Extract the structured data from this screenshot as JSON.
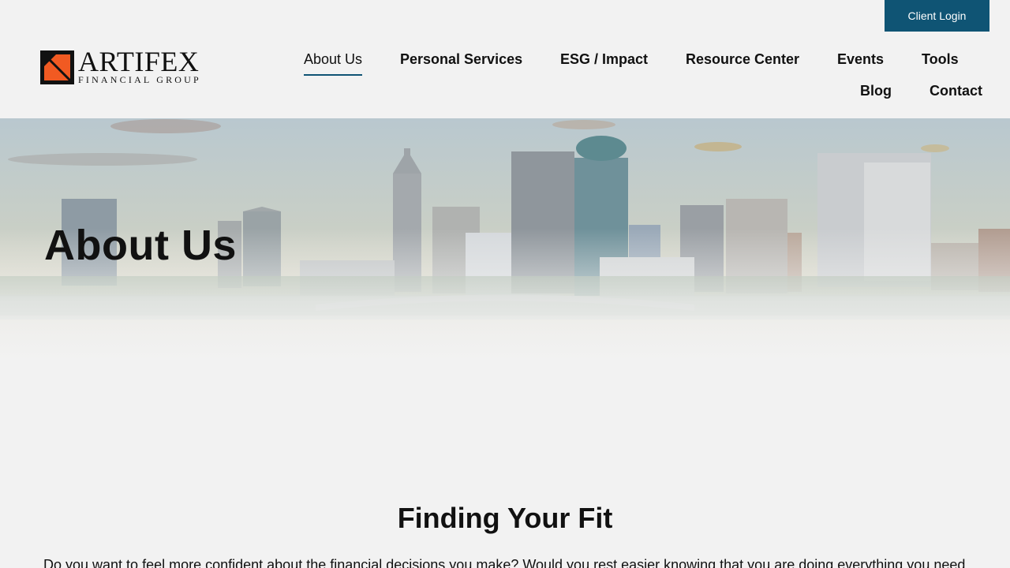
{
  "header": {
    "client_login": "Client Login",
    "logo": {
      "name": "ARTIFEX",
      "subtitle": "FINANCIAL GROUP"
    },
    "nav": [
      {
        "label": "About Us",
        "active": true
      },
      {
        "label": "Personal Services"
      },
      {
        "label": "ESG / Impact"
      },
      {
        "label": "Resource Center"
      },
      {
        "label": "Events"
      },
      {
        "label": "Tools"
      },
      {
        "label": "Blog"
      },
      {
        "label": "Contact"
      }
    ]
  },
  "hero": {
    "title": "About Us"
  },
  "main": {
    "section_title": "Finding Your Fit",
    "intro": "Do you want to feel more confident about the financial decisions you make? Would you rest easier knowing that you are doing everything you need"
  },
  "colors": {
    "accent": "#0f5474",
    "logo_orange": "#f15a22",
    "background": "#f2f2f2"
  }
}
